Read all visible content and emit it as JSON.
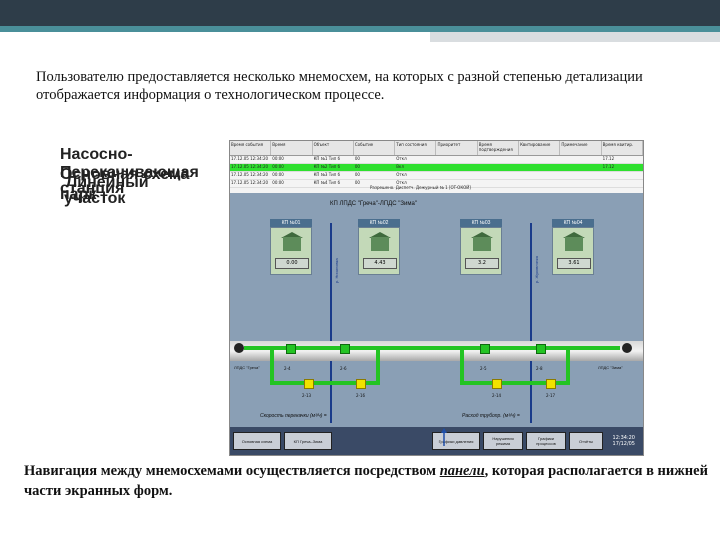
{
  "intro_text": "Пользователю предоставляется несколько мнемосхем, на которых с разной степенью детализации отображается информация о технологическом процессе.",
  "stacked_titles": [
    "Насосно-",
    "Перекачивающая",
    "станция",
    "Основная схема",
    "Линейный",
    "участок",
    "парк"
  ],
  "events_table": {
    "headers": [
      "Время события",
      "Время",
      "Объект",
      "Событие",
      "Тип состояния",
      "Приоритет",
      "Время подтверждения",
      "Квитирование",
      "Примечание",
      "Время квитир."
    ],
    "rows": [
      [
        "17.12.05 12:34:20",
        "00:00",
        "КП №1 Тип б",
        "00",
        "Откл",
        "",
        "",
        "",
        "",
        "17.12"
      ],
      [
        "17.12.05 12:34:20",
        "00:00",
        "КП №2 Тип б",
        "00",
        "Вкл",
        "",
        "",
        "",
        "",
        "17.12"
      ],
      [
        "17.12.05 12:34:20",
        "00:00",
        "КП №3 Тип б",
        "00",
        "Откл",
        "",
        "",
        "",
        "",
        ""
      ],
      [
        "17.12.05 12:34:20",
        "00:00",
        "КП №4 Тип б",
        "00",
        "Откл",
        "",
        "",
        "",
        "",
        ""
      ]
    ],
    "footer": "Разрешено. Диспетч. Дежурный № 1 [OT-ОКОЙ]"
  },
  "mnemo_title": "КП ЛПДС \"Греча\"-ЛПДС \"Зима\"",
  "kp_units": [
    {
      "label": "КП №01",
      "value": "0.00"
    },
    {
      "label": "КП №02",
      "value": "4.43"
    },
    {
      "label": "КП №03",
      "value": "3.2"
    },
    {
      "label": "КП №04",
      "value": "3.61"
    }
  ],
  "rivers": [
    "р. Ничиловка",
    "р. Жуковлянка"
  ],
  "valve_tags": [
    "2-4",
    "2-6",
    "2-5",
    "2-8",
    "2-13",
    "2-16",
    "2-14",
    "2-17"
  ],
  "end_labels": {
    "left": "ЛПДС \"Греча\"",
    "right": "ЛПДС \"Зима\""
  },
  "rates": {
    "left": "Скорость перекачки (м³/ч) =",
    "right": "Расход трубопр. (м³/ч) ="
  },
  "nav": {
    "buttons": [
      "Основная схема",
      "КП Греча–Зима",
      "Графики давления",
      "Нарушения режима",
      "Графики процессов",
      "Отчёты"
    ],
    "time": "12:34:20",
    "date": "17/12/05"
  },
  "bottom_text": {
    "before": "Навигация между мнемосхемами осуществляется посредством ",
    "link": "панели",
    "after": ", которая располагается в нижней части экранных форм."
  },
  "colors": {
    "header_dark": "#2e3d49",
    "accent_teal": "#4a8f99",
    "pipe_green": "#23c423",
    "valve_yellow": "#f2e200",
    "nav_bar": "#3a4a66"
  }
}
